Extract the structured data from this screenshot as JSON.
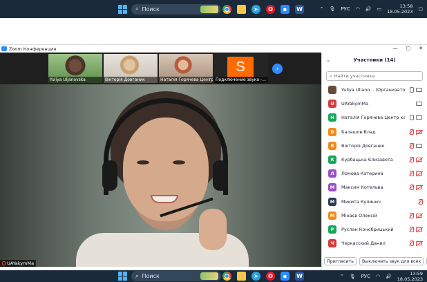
{
  "taskbar": {
    "search_label": "Поиск",
    "language": "РУС",
    "time_top": "13:58",
    "date_top": "18.05.2023",
    "time_bottom": "13:59",
    "date_bottom": "18.05.2023",
    "apps": [
      "chrome-icon",
      "file-explorer-icon",
      "telegram-icon",
      "opera-icon",
      "zoom-icon",
      "word-icon"
    ]
  },
  "window": {
    "title": "Zoom Конференция"
  },
  "gallery": {
    "tiles": [
      {
        "name": "Yuliya Uljanovska"
      },
      {
        "name": "Вікторія Довганик"
      },
      {
        "name": "Наталія Горячева Центр ..."
      },
      {
        "name": "Подключение звука -...",
        "initial": "S"
      }
    ]
  },
  "main_video": {
    "name": "UAYakymMa"
  },
  "participants": {
    "title": "Участники (14)",
    "search_placeholder": "Найти участника",
    "list": [
      {
        "name": "Yuliya Uliano... (Организатор, я)",
        "initial": "",
        "color": "#6b4b3a",
        "mic": "on",
        "cam": "on"
      },
      {
        "name": "UAYakymMa",
        "initial": "U",
        "color": "#d93a3a",
        "mic": "none",
        "cam": "on"
      },
      {
        "name": "Наталія Горячева Центр кар'є...",
        "initial": "Н",
        "color": "#1aa65a",
        "mic": "on",
        "cam": "on"
      },
      {
        "name": "Балашов Влад",
        "initial": "Б",
        "color": "#f28a1a",
        "mic": "off",
        "cam": "off"
      },
      {
        "name": "Вікторія Довганик",
        "initial": "В",
        "color": "#f28a1a",
        "mic": "off",
        "cam": "on"
      },
      {
        "name": "Курбацька Єлизавета",
        "initial": "К",
        "color": "#1aa65a",
        "mic": "off",
        "cam": "off"
      },
      {
        "name": "Ломова Катерина",
        "initial": "Л",
        "color": "#9a4fc4",
        "mic": "off",
        "cam": "off"
      },
      {
        "name": "Максим Котельва",
        "initial": "М",
        "color": "#9a4fc4",
        "mic": "off",
        "cam": "off"
      },
      {
        "name": "Микита Кулинич",
        "initial": "М",
        "color": "#2a3d55",
        "mic": "off",
        "cam": "none"
      },
      {
        "name": "Мінаєв Олексій",
        "initial": "М",
        "color": "#f28a1a",
        "mic": "off",
        "cam": "off"
      },
      {
        "name": "Руслан Конобрицький",
        "initial": "Р",
        "color": "#1aa65a",
        "mic": "off",
        "cam": "off"
      },
      {
        "name": "Черкасский Данил",
        "initial": "Ч",
        "color": "#d93a3a",
        "mic": "off",
        "cam": "off"
      }
    ],
    "invite_label": "Пригласить",
    "mute_all_label": "Выключить звук для всех",
    "more_label": "..."
  }
}
